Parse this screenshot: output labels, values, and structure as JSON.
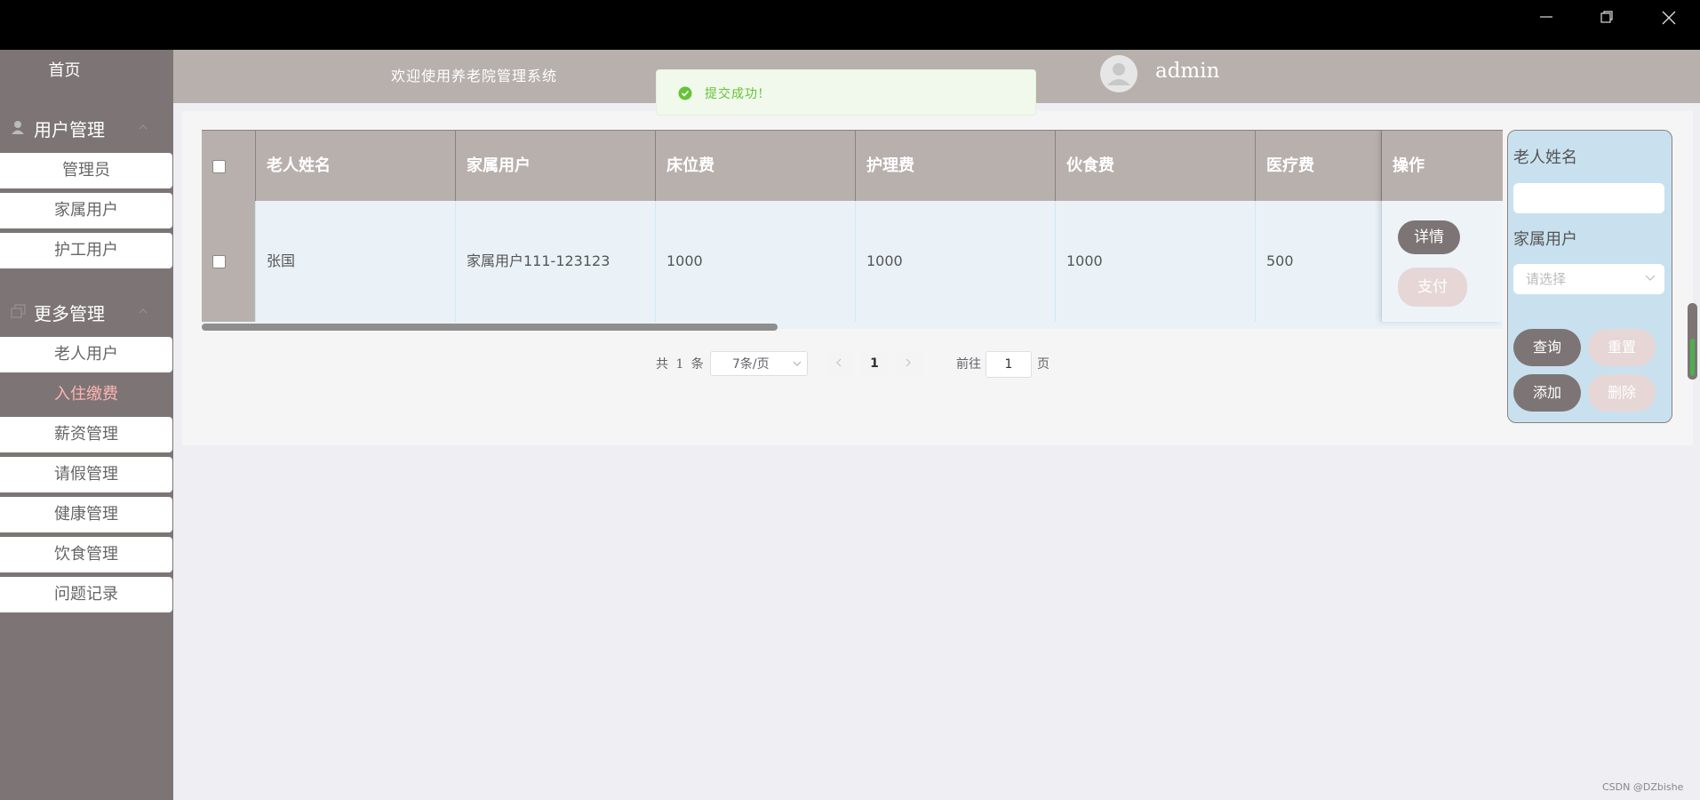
{
  "sidebar": {
    "home": "首页",
    "groups": [
      {
        "label": "用户管理",
        "items": [
          "管理员",
          "家属用户",
          "护工用户"
        ]
      },
      {
        "label": "更多管理",
        "items": [
          "老人用户",
          "入住缴费",
          "薪资管理",
          "请假管理",
          "健康管理",
          "饮食管理",
          "问题记录"
        ]
      }
    ],
    "active_item": "入住缴费"
  },
  "header": {
    "title": "欢迎使用养老院管理系统",
    "username": "admin"
  },
  "toast": {
    "message": "提交成功!",
    "color": "#67c23a"
  },
  "table": {
    "columns": [
      "老人姓名",
      "家属用户",
      "床位费",
      "护理费",
      "伙食费",
      "医疗费",
      "操作"
    ],
    "rows": [
      {
        "name": "张国",
        "family": "家属用户111-123123",
        "bed": "1000",
        "care": "1000",
        "food": "1000",
        "medical": "500"
      }
    ],
    "row_actions": {
      "detail": "详情",
      "pay": "支付"
    }
  },
  "pagination": {
    "total": "共 1 条",
    "page_size": "7条/页",
    "current": "1",
    "goto_label": "前往",
    "goto_value": "1",
    "goto_unit": "页"
  },
  "search": {
    "name_label": "老人姓名",
    "name_value": "",
    "family_label": "家属用户",
    "family_placeholder": "请选择",
    "buttons": {
      "query": "查询",
      "reset": "重置",
      "add": "添加",
      "delete": "删除"
    }
  },
  "watermark": "CSDN @DZbishe",
  "colors": {
    "sidebar_bg": "#7d7575",
    "header_bg": "#b8b0ad",
    "active_text": "#ffb3b3",
    "search_panel_bg": "#c9e1ef"
  }
}
